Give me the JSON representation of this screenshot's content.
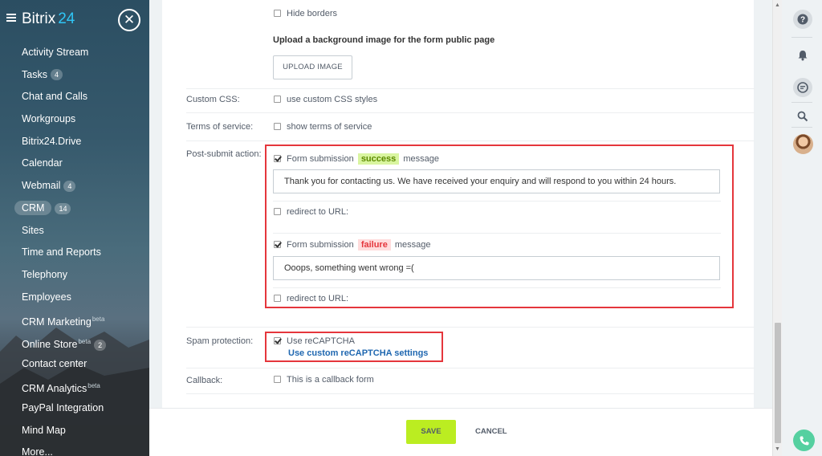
{
  "sidebar": {
    "logo_text": "Bitrix",
    "logo_num": "24",
    "close_glyph": "✕",
    "items": [
      {
        "label": "Activity Stream"
      },
      {
        "label": "Tasks",
        "badge": "4"
      },
      {
        "label": "Chat and Calls"
      },
      {
        "label": "Workgroups"
      },
      {
        "label": "Bitrix24.Drive"
      },
      {
        "label": "Calendar"
      },
      {
        "label": "Webmail",
        "badge": "4"
      },
      {
        "label": "CRM",
        "badge": "14"
      },
      {
        "label": "Sites"
      },
      {
        "label": "Time and Reports"
      },
      {
        "label": "Telephony"
      },
      {
        "label": "Employees"
      },
      {
        "label": "CRM Marketing",
        "sup": "beta"
      },
      {
        "label": "Online Store",
        "sup": "beta",
        "badge": "2"
      },
      {
        "label": "Contact center"
      },
      {
        "label": "CRM Analytics",
        "sup": "beta"
      },
      {
        "label": "PayPal Integration"
      },
      {
        "label": "Mind Map"
      },
      {
        "label": "More..."
      }
    ]
  },
  "form": {
    "hide_borders": "Hide borders",
    "bg_title": "Upload a background image for the form public page",
    "upload_button": "UPLOAD IMAGE",
    "custom_css_label": "Custom CSS:",
    "custom_css_option": "use custom CSS styles",
    "terms_label": "Terms of service:",
    "terms_option": "show terms of service",
    "post_submit_label": "Post-submit action:",
    "success_prefix": "Form submission",
    "success_tag": "success",
    "success_suffix": "message",
    "success_message": "Thank you for contacting us. We have received your enquiry and will respond to you within 24 hours.",
    "redirect_success": "redirect to URL:",
    "failure_prefix": "Form submission",
    "failure_tag": "failure",
    "failure_suffix": "message",
    "failure_message": "Ooops, something went wrong =(",
    "redirect_failure": "redirect to URL:",
    "spam_label": "Spam protection:",
    "recaptcha_option": "Use reCAPTCHA",
    "recaptcha_link": "Use custom reCAPTCHA settings",
    "callback_label": "Callback:",
    "callback_option": "This is a callback form"
  },
  "footer": {
    "save": "SAVE",
    "cancel": "CANCEL"
  },
  "colors": {
    "accent_green": "#bbed21",
    "highlight_red": "#e5363c",
    "link_blue": "#1f67b0"
  }
}
